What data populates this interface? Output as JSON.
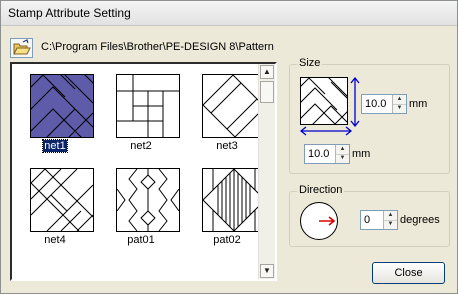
{
  "window": {
    "title": "Stamp Attribute Setting"
  },
  "toolbar": {
    "folder_icon": "open-folder-icon",
    "path": "C:\\Program Files\\Brother\\PE-DESIGN 8\\Pattern"
  },
  "patterns": [
    {
      "label": "net1",
      "selected": true
    },
    {
      "label": "net2",
      "selected": false
    },
    {
      "label": "net3",
      "selected": false
    },
    {
      "label": "net4",
      "selected": false
    },
    {
      "label": "pat01",
      "selected": false
    },
    {
      "label": "pat02",
      "selected": false
    }
  ],
  "size": {
    "title": "Size",
    "height_value": "10.0",
    "width_value": "10.0",
    "unit": "mm"
  },
  "direction": {
    "title": "Direction",
    "value": "0",
    "unit": "degrees"
  },
  "buttons": {
    "close": "Close"
  },
  "colors": {
    "selection": "#0A246A",
    "selected_tile": "#5E5CA9",
    "arrow": "#0000CC",
    "direction_arrow": "#DD0000"
  }
}
